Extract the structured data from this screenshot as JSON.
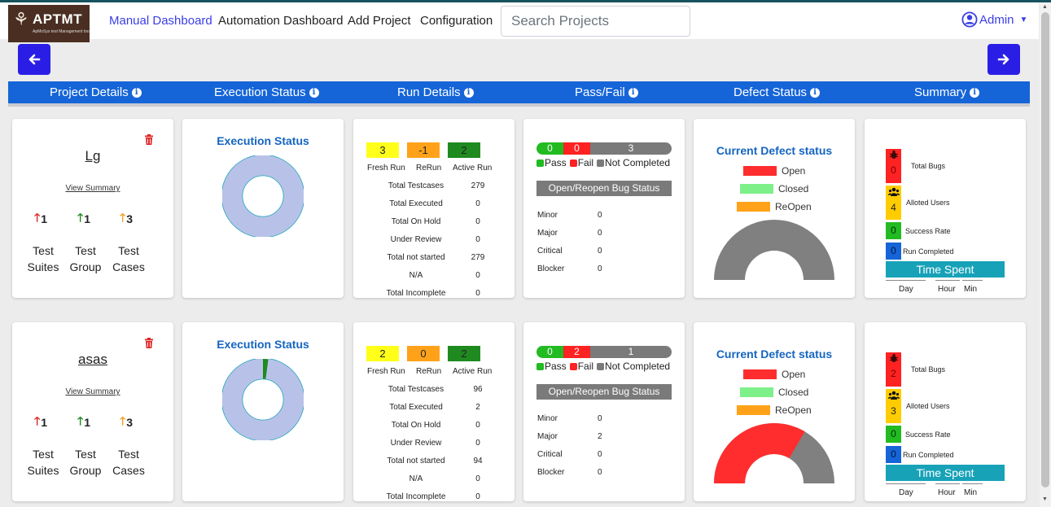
{
  "app": {
    "logo_text": "APTMT",
    "logo_subtitle": "ApMoSys test Management tool"
  },
  "nav": {
    "items": [
      "Manual Dashboard",
      "Automation Dashboard",
      "Add Project",
      "Configuration"
    ],
    "search_placeholder": "Search Projects",
    "user": "Admin"
  },
  "columns": [
    "Project Details",
    "Execution Status",
    "Run Details",
    "Pass/Fail",
    "Defect Status",
    "Summary"
  ],
  "colors": {
    "accent": "#1565d8",
    "nav_button": "#2a1ee6",
    "pass": "#22bb22",
    "fail": "#ff2222",
    "not_completed": "#7a7a7a",
    "donut": "#b8c2e8"
  },
  "labels": {
    "view_summary": "View Summary",
    "test_suites": [
      "Test",
      "Suites"
    ],
    "test_group": [
      "Test",
      "Group"
    ],
    "test_cases": [
      "Test",
      "Cases"
    ],
    "execution_status": "Execution Status",
    "fresh_run": "Fresh Run",
    "rerun": "ReRun",
    "active_run": "Active Run",
    "run_rows": [
      "Total Testcases",
      "Total Executed",
      "Total On Hold",
      "Under Review",
      "Total not started",
      "N/A",
      "Total Incomplete"
    ],
    "pass": "Pass",
    "fail": "Fail",
    "not_completed": "Not Completed",
    "bug_status": "Open/Reopen Bug Status",
    "severity": [
      "Minor",
      "Major",
      "Critical",
      "Blocker"
    ],
    "defect_title": "Current Defect status",
    "open": "Open",
    "closed": "Closed",
    "reopen": "ReOpen",
    "total_bugs": "Total Bugs",
    "alloted_users": "Alloted Users",
    "success_rate": "Success Rate",
    "run_completed": "Run Completed",
    "time_spent": "Time Spent",
    "day": "Day",
    "hour": "Hour",
    "min": "Min"
  },
  "projects": [
    {
      "name": "Lg",
      "suites": "1",
      "groups": "1",
      "cases": "3",
      "executed_fraction": 0.0,
      "fresh_run": "3",
      "rerun": "-1",
      "active_run": "2",
      "run_values": [
        "279",
        "0",
        "0",
        "0",
        "279",
        "0",
        "0"
      ],
      "pass": "0",
      "fail": "0",
      "not_completed": "3",
      "severity_values": [
        "0",
        "0",
        "0",
        "0"
      ],
      "defect_open_fraction": 0.0,
      "total_bugs": "0",
      "alloted_users": "4",
      "success_rate": "0",
      "run_completed": "0"
    },
    {
      "name": "asas",
      "suites": "1",
      "groups": "1",
      "cases": "3",
      "executed_fraction": 0.021,
      "fresh_run": "2",
      "rerun": "0",
      "active_run": "2",
      "run_values": [
        "96",
        "2",
        "0",
        "0",
        "94",
        "0",
        "0"
      ],
      "pass": "0",
      "fail": "2",
      "not_completed": "1",
      "severity_values": [
        "0",
        "2",
        "0",
        "0"
      ],
      "defect_open_fraction": 0.67,
      "total_bugs": "2",
      "alloted_users": "3",
      "success_rate": "0",
      "run_completed": "0"
    }
  ]
}
